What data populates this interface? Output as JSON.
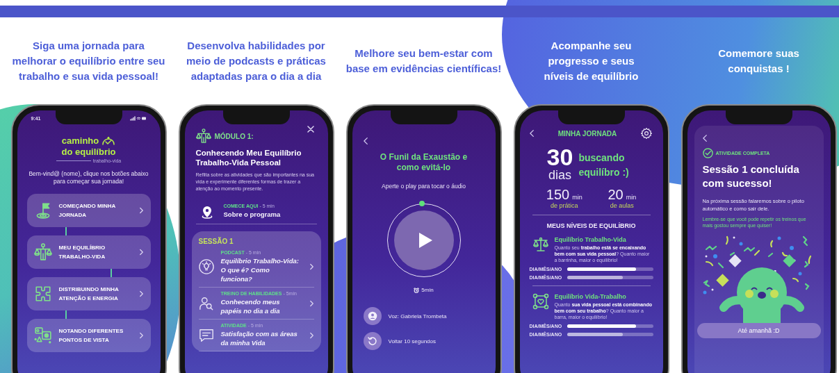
{
  "panels": [
    {
      "headline": "Siga uma jornada para melhorar o equilíbrio entre seu trabalho e sua vida pessoal!",
      "inverted": false,
      "screen": {
        "kind": "home",
        "time": "9:41",
        "logo": {
          "line_1": "caminho",
          "line_2": "do equilíbrio",
          "tagline": "trabalho-vida"
        },
        "intro": "Bem-vind@ (nome), clique nos botões abaixo para começar sua jornada!",
        "items": [
          {
            "kind": "flag",
            "label": "COMEÇANDO MINHA JORNADA"
          },
          {
            "kind": "balance",
            "label": "MEU EQUILÍBRIO TRABALHO-VIDA"
          },
          {
            "kind": "puzzle",
            "label": "DISTRIBUINDO MINHA ATENÇÃO E ENERGIA"
          },
          {
            "kind": "views",
            "label": "NOTANDO DIFERENTES PONTOS DE VISTA"
          }
        ]
      }
    },
    {
      "headline": "Desenvolva habilidades por meio de podcasts e práticas adaptadas para o dia a dia",
      "inverted": false,
      "screen": {
        "kind": "module",
        "module_label": "MÓDULO 1:",
        "title": "Conhecendo Meu Equilíbrio Trabalho-Vida Pessoal",
        "description": "Reflita sobre as atividades que são importantes na sua vida e experimente diferentes formas de trazer a atenção ao momento presente.",
        "start": {
          "tag": "COMECE AQUI",
          "duration": "- 5 min",
          "title": "Sobre o programa"
        },
        "session": {
          "title": "SESSÃO 1",
          "items": [
            {
              "kind": "podcast",
              "tag": "PODCAST",
              "duration": "- 5 min",
              "title": "Equilíbrio Trabalho-Vida: O que é? Como funciona?"
            },
            {
              "kind": "skill",
              "tag": "TREINO DE HABILIDADES",
              "duration": "- 5min",
              "title": "Conhecendo meus papéis no dia a dia"
            },
            {
              "kind": "activity",
              "tag": "ATIVIDADE",
              "duration": "- 5 min",
              "title": "Satisfação com as áreas da minha Vida"
            }
          ]
        }
      }
    },
    {
      "headline": "Melhore seu bem-estar com base em evidências científicas!",
      "inverted": false,
      "screen": {
        "kind": "player",
        "title": "O Funil da Exaustão e como evitá-lo",
        "prompt": "Aperte o play para tocar o áudio",
        "duration": "5min",
        "rows": [
          {
            "kind": "voice",
            "label": "Voz: Gabriela Trombeta"
          },
          {
            "kind": "rewind",
            "label": "Voltar 10 segundos"
          }
        ]
      }
    },
    {
      "headline": "Acompanhe seu progresso e seus níveis de equilíbrio",
      "inverted": true,
      "screen": {
        "kind": "journey",
        "title": "MINHA JORNADA",
        "days": "30",
        "days_label": "dias",
        "tagline": "buscando equilíbro :)",
        "stats": [
          {
            "value": "150",
            "unit": "min",
            "label": "de prática"
          },
          {
            "value": "20",
            "unit": "min",
            "label": "de aulas"
          }
        ],
        "section_title": "MEUS NÍVEIS DE EQUILÍBRIO",
        "levels": [
          {
            "kind": "balance",
            "title": "Equilíbrio Trabalho-Vida",
            "description": "Quanto seu **trabalho está se encaixando bem com sua vida pessoal**? Quanto maior a barrinha, maior o equilíbrio!",
            "bars": [
              {
                "label": "DIA/MÊS/ANO",
                "highlighted": true,
                "level": 0.8
              },
              {
                "label": "DIA/MÊS/ANO",
                "highlighted": false,
                "level": 0.65
              }
            ]
          },
          {
            "kind": "life",
            "title": "Equilíbrio Vida-Trabalho",
            "description": "Quanto **sua vida pessoal está combinando bem com seu trabalho**? Quanto maior a barra, maior o equilíbrio!",
            "bars": [
              {
                "label": "DIA/MÊS/ANO",
                "highlighted": true,
                "level": 0.8
              },
              {
                "label": "DIA/MÊS/ANO",
                "highlighted": false,
                "level": 0.65
              }
            ]
          }
        ]
      }
    },
    {
      "headline": "Comemore suas conquistas !",
      "inverted": true,
      "screen": {
        "kind": "complete",
        "status": "ATIVIDADE COMPLETA",
        "title": "Sessão 1 concluída com sucesso!",
        "message": "Na próxima sessão falaremos sobre o piloto automático e como sair dele.",
        "note": "Lembre-se que você pode repetir os treinos que mais gostou sempre que quiser!",
        "button": "Até amanhã :D"
      }
    }
  ]
}
